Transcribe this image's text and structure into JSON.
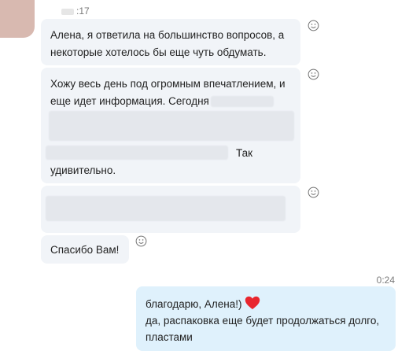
{
  "incoming": {
    "time_suffix": ":17",
    "messages": [
      {
        "lines": [
          "Алена, я ответила на большинство вопросов, а",
          "некоторые хотелось бы еще чуть обдумать."
        ]
      },
      {
        "line1": "Хожу весь день под огромным впечатлением, и",
        "line2": "еще идет информация. Сегодня",
        "line4_tail": "Так",
        "line5": "удивительно."
      },
      {
        "redacted": true
      },
      {
        "text": "Спасибо Вам!"
      }
    ]
  },
  "outgoing": {
    "timestamp": "0:24",
    "line1": "благодарю, Алена!)",
    "line2": "да, распаковка еще будет продолжаться долго,",
    "line3": "пластами"
  },
  "icons": {
    "reaction": "smiley-icon",
    "heart": "heart-icon"
  },
  "colors": {
    "incoming_bubble": "#f1f4f8",
    "outgoing_bubble": "#dff1fc",
    "heart": "#e8262e"
  }
}
